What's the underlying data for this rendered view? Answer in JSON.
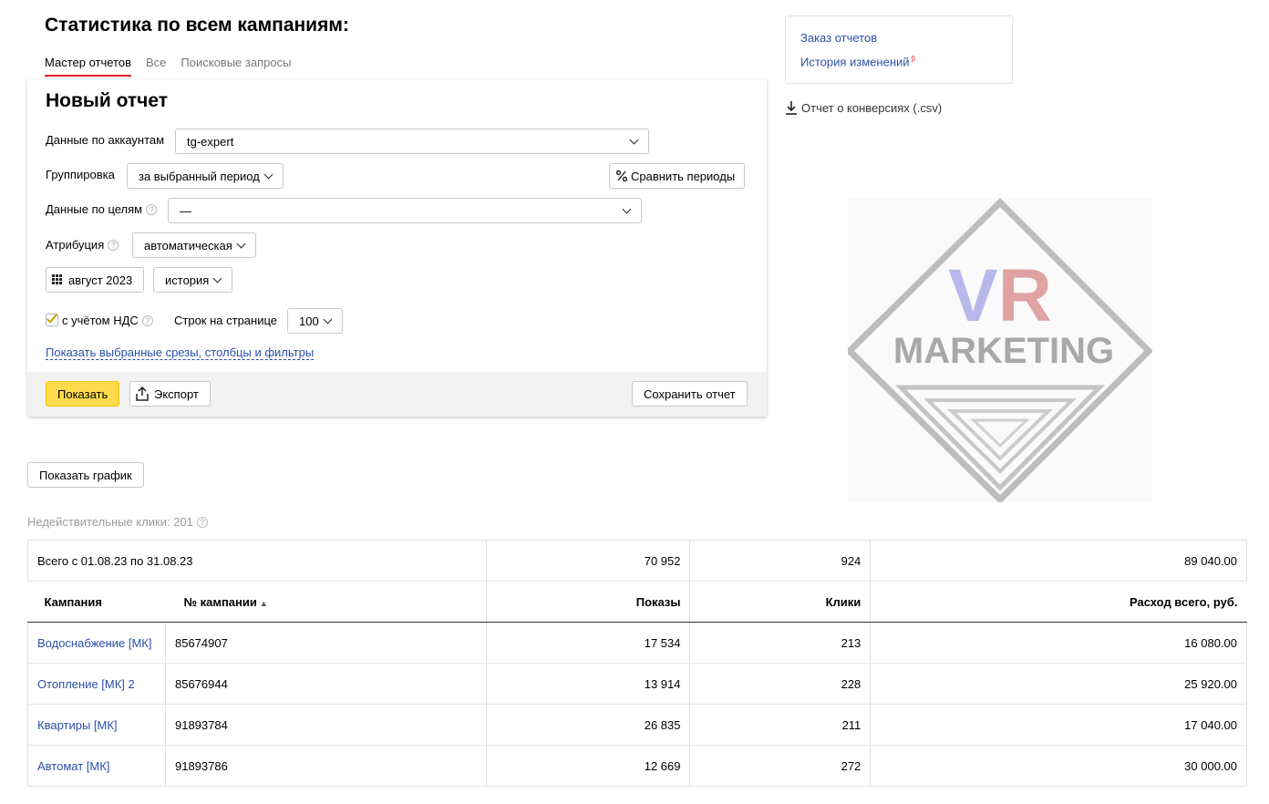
{
  "page_title": "Статистика по всем кампаниям:",
  "tabs": [
    {
      "label": "Мастер отчетов",
      "active": true
    },
    {
      "label": "Все",
      "active": false
    },
    {
      "label": "Поисковые запросы",
      "active": false
    }
  ],
  "report": {
    "title": "Новый отчет",
    "accounts_label": "Данные по аккаунтам",
    "accounts_value": "tg-expert",
    "grouping_label": "Группировка",
    "grouping_value": "за выбранный период",
    "compare_button": "Сравнить периоды",
    "goals_label": "Данные по целям",
    "goals_value": "—",
    "attribution_label": "Атрибуция",
    "attribution_value": "автоматическая",
    "period_value": "август 2023",
    "history_value": "история",
    "vat_label": "с учётом НДС",
    "vat_checked": true,
    "rows_label": "Строк на странице",
    "rows_value": "100",
    "show_slices_link": "Показать выбранные срезы, столбцы и фильтры",
    "show_button": "Показать",
    "export_button": "Экспорт",
    "save_button": "Сохранить отчет"
  },
  "side": {
    "order_reports": "Заказ отчетов",
    "change_history": "История изменений",
    "beta": "β",
    "conversions_csv": "Отчет о конверсиях (.csv)"
  },
  "watermark": {
    "text_top": "VR",
    "text_bottom": "MARKETING"
  },
  "show_chart_button": "Показать график",
  "invalid_clicks": "Недействительные клики: 201",
  "table": {
    "total_row": {
      "label": "Всего с 01.08.23 по 31.08.23",
      "impressions": "70 952",
      "clicks": "924",
      "spend": "89 040.00"
    },
    "headers": {
      "campaign": "Кампания",
      "campaign_no": "№ кампании",
      "impressions": "Показы",
      "clicks": "Клики",
      "spend": "Расход всего, руб."
    },
    "rows": [
      {
        "campaign": "Водоснабжение [МК]",
        "id": "85674907",
        "impressions": "17 534",
        "clicks": "213",
        "spend": "16 080.00"
      },
      {
        "campaign": "Отопление [МК] 2",
        "id": "85676944",
        "impressions": "13 914",
        "clicks": "228",
        "spend": "25 920.00"
      },
      {
        "campaign": "Квартиры [МК]",
        "id": "91893784",
        "impressions": "26 835",
        "clicks": "211",
        "spend": "17 040.00"
      },
      {
        "campaign": "Автомат [МК]",
        "id": "91893786",
        "impressions": "12 669",
        "clicks": "272",
        "spend": "30 000.00"
      }
    ]
  },
  "colors": {
    "accent_yellow": "#ffdb4d",
    "link_blue": "#2a4fa8",
    "tab_underline": "#dd2222"
  }
}
